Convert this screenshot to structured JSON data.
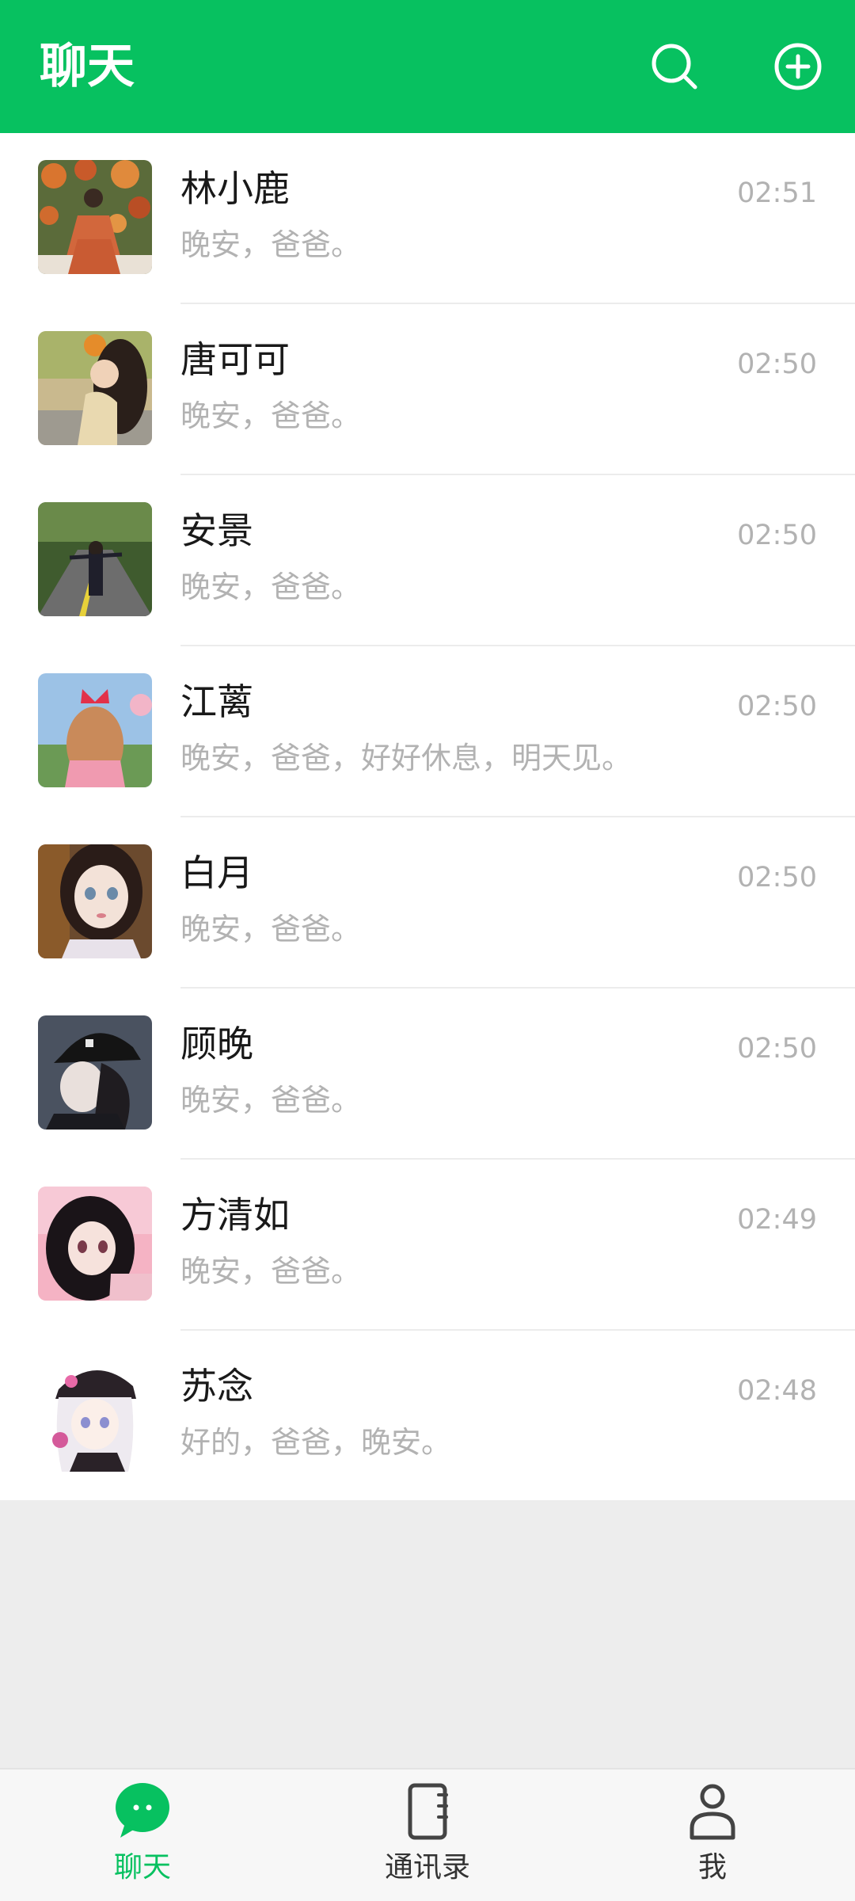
{
  "header": {
    "title": "聊天",
    "search_icon": "search-icon",
    "add_icon": "add-circle-icon"
  },
  "chats": [
    {
      "name": "林小鹿",
      "preview": "晚安，爸爸。",
      "time": "02:51"
    },
    {
      "name": "唐可可",
      "preview": "晚安，爸爸。",
      "time": "02:50"
    },
    {
      "name": "安景",
      "preview": "晚安，爸爸。",
      "time": "02:50"
    },
    {
      "name": "江蓠",
      "preview": "晚安，爸爸，好好休息，明天见。",
      "time": "02:50"
    },
    {
      "name": "白月",
      "preview": "晚安，爸爸。",
      "time": "02:50"
    },
    {
      "name": "顾晚",
      "preview": "晚安，爸爸。",
      "time": "02:50"
    },
    {
      "name": "方清如",
      "preview": "晚安，爸爸。",
      "time": "02:49"
    },
    {
      "name": "苏念",
      "preview": "好的，爸爸，晚安。",
      "time": "02:48"
    }
  ],
  "tabbar": {
    "tabs": [
      {
        "label": "聊天",
        "icon": "chat-bubble-icon",
        "active": true
      },
      {
        "label": "通讯录",
        "icon": "contacts-book-icon",
        "active": false
      },
      {
        "label": "我",
        "icon": "person-icon",
        "active": false
      }
    ]
  },
  "colors": {
    "accent": "#07c160",
    "header_bg": "#07c160",
    "list_bg": "#ffffff",
    "page_bg": "#ededed",
    "muted_text": "#b2b2b2"
  }
}
